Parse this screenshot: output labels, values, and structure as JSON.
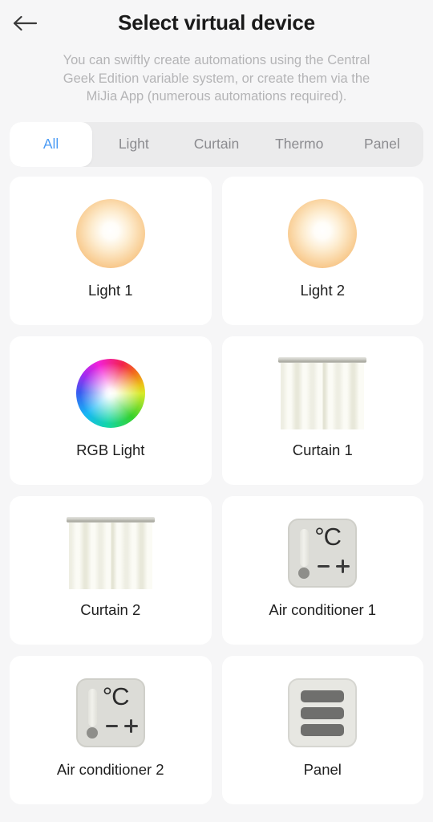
{
  "header": {
    "back_icon": "arrow-left-icon",
    "title": "Select virtual device",
    "subtitle": "You can swiftly create automations using the Central Geek Edition variable system, or create them via the MiJia App (numerous automations required)."
  },
  "tabs": {
    "active": "All",
    "items": [
      {
        "label": "All",
        "selected": true
      },
      {
        "label": "Light",
        "selected": false
      },
      {
        "label": "Curtain",
        "selected": false
      },
      {
        "label": "Thermo",
        "selected": false
      },
      {
        "label": "Panel",
        "selected": false
      }
    ]
  },
  "devices": [
    {
      "label": "Light 1",
      "icon": "light-bulb-icon",
      "type": "light"
    },
    {
      "label": "Light 2",
      "icon": "light-bulb-icon",
      "type": "light"
    },
    {
      "label": "RGB Light",
      "icon": "rgb-color-wheel-icon",
      "type": "rgb"
    },
    {
      "label": "Curtain 1",
      "icon": "curtain-icon",
      "type": "curtain"
    },
    {
      "label": "Curtain 2",
      "icon": "curtain-icon",
      "type": "curtain"
    },
    {
      "label": "Air conditioner 1",
      "icon": "thermostat-icon",
      "type": "thermo"
    },
    {
      "label": "Air conditioner 2",
      "icon": "thermostat-icon",
      "type": "thermo"
    },
    {
      "label": "Panel",
      "icon": "switch-panel-icon",
      "type": "panel"
    }
  ],
  "thermo_icon": {
    "degree_label": "°C",
    "minus_label": "−",
    "plus_label": "+"
  },
  "colors": {
    "page_background": "#f6f6f7",
    "card_background": "#ffffff",
    "tab_strip_background": "#ebebec",
    "tab_active_text": "#4b9bf5",
    "tab_inactive_text": "#8b8b8f",
    "title_text": "#1a1a1a",
    "subtitle_text": "#b4b4b6",
    "bulb_edge": "#f3ae66",
    "device_panel_gray": "#dcdcd7",
    "panel_bar_gray": "#6f6f6d"
  }
}
